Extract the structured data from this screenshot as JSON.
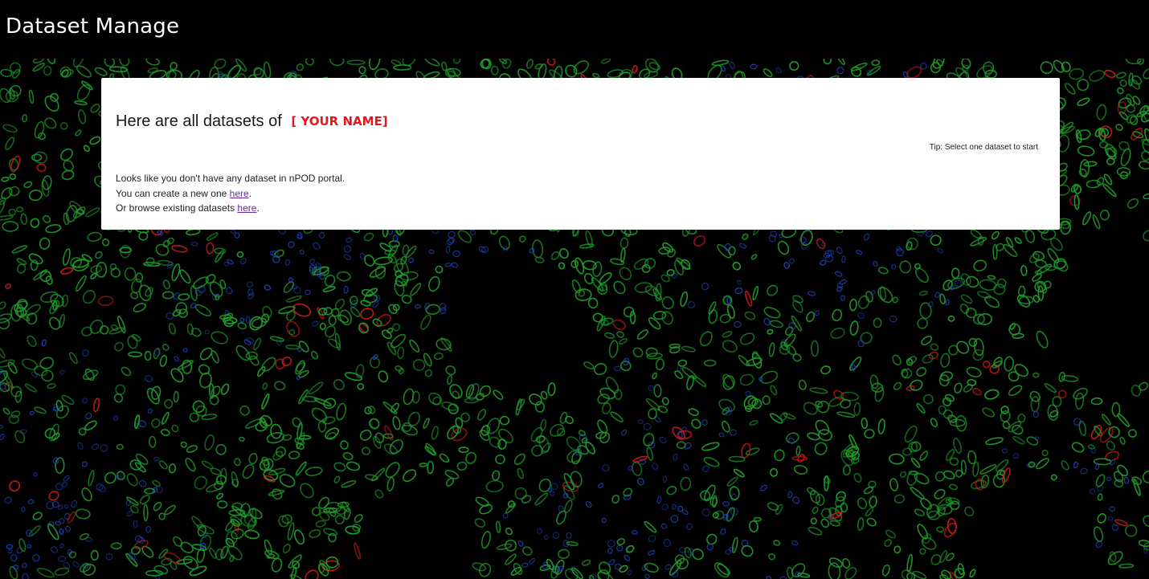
{
  "header": {
    "title": "Dataset Manage"
  },
  "panel": {
    "heading": "Here are all datasets of",
    "user_name": "[ YOUR NAME]",
    "tip": "Tip: Select one dataset to start",
    "empty_message": {
      "line1": "Looks like you don't have any dataset in nPOD portal.",
      "line2_prefix": "You can create a new one ",
      "line2_link": "here",
      "line2_suffix": ".",
      "line3_prefix": "Or browse existing datasets ",
      "line3_link": "here",
      "line3_suffix": "."
    }
  },
  "colors": {
    "accent_name": "#e8141e",
    "link": "#6a2aa8",
    "bg_green": "#1f9a2a",
    "bg_blue": "#1f3fb4",
    "bg_red": "#c81818"
  }
}
